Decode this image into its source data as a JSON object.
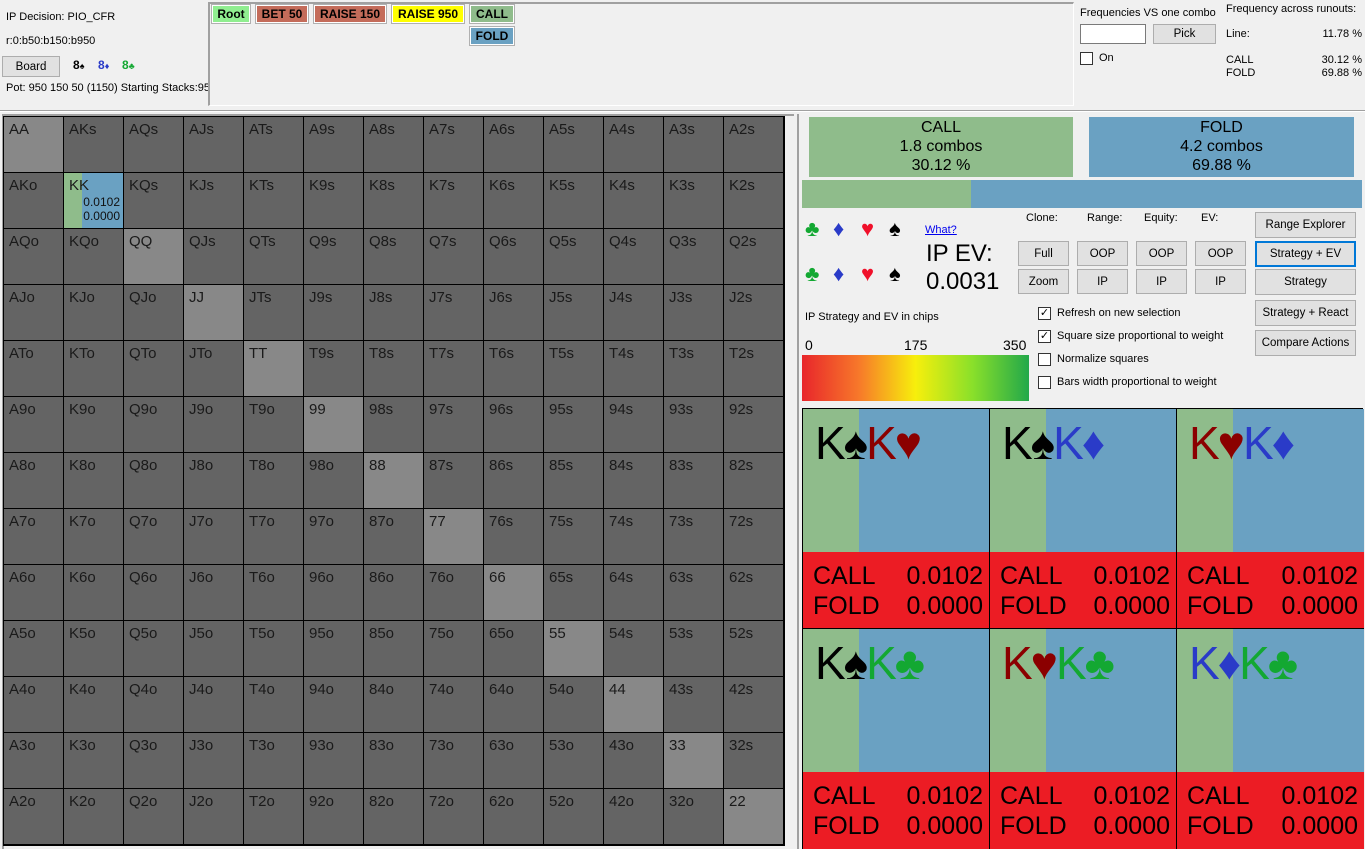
{
  "info": {
    "decision": "IP Decision:  PIO_CFR",
    "line": "r:0:b50:b150:b950",
    "board_button": "Board",
    "board_cards": [
      {
        "rank": "8",
        "suit": "♠",
        "color": "#000000"
      },
      {
        "rank": "8",
        "suit": "♦",
        "color": "#2a3bc8"
      },
      {
        "rank": "8",
        "suit": "♣",
        "color": "#13a832"
      }
    ],
    "pot": "Pot: 950 150 50 (1150) Starting Stacks:95"
  },
  "tree": {
    "nodes": [
      {
        "label": "Root",
        "color": "#90ee90"
      },
      {
        "label": "BET 50",
        "color": "#c46c5a"
      },
      {
        "label": "RAISE 150",
        "color": "#c46c5a"
      },
      {
        "label": "RAISE 950",
        "color": "#ffff00"
      },
      {
        "label": "CALL",
        "color": "#8fbc8b"
      },
      {
        "label": "FOLD",
        "color": "#6aa1c2"
      }
    ]
  },
  "freq_vs_combo": {
    "title": "Frequencies VS one combo",
    "input_value": "",
    "pick_button": "Pick",
    "on_label": "On",
    "on_checked": false
  },
  "freq_runouts": {
    "title": "Frequency across runouts:",
    "line_label": "Line:",
    "line_value": "11.78 %",
    "rows": [
      {
        "label": "CALL",
        "value": "30.12 %"
      },
      {
        "label": "FOLD",
        "value": "69.88 %"
      }
    ]
  },
  "grid": {
    "ranks": [
      "A",
      "K",
      "Q",
      "J",
      "T",
      "9",
      "8",
      "7",
      "6",
      "5",
      "4",
      "3",
      "2"
    ],
    "selected": {
      "hand": "KK",
      "call_frac": 0.3012,
      "ev_call": "0.0102",
      "ev_fold": "0.0000"
    }
  },
  "actions": [
    {
      "label": "CALL",
      "combos": "1.8 combos",
      "pct": "30.12 %",
      "frac": 0.3012,
      "color": "#8fbc8b"
    },
    {
      "label": "FOLD",
      "combos": "4.2 combos",
      "pct": "69.88 %",
      "frac": 0.6988,
      "color": "#6aa1c2"
    }
  ],
  "ev_panel": {
    "what_link": "What?",
    "ev_label": "IP EV:",
    "ev_value": "0.0031",
    "suits_row1": [
      "♣",
      "♦",
      "♥",
      "♠"
    ],
    "suits_row2": [
      "♣",
      "♦",
      "♥",
      "♠"
    ],
    "legend_title": "IP Strategy and EV in chips",
    "gradient_ticks": [
      "0",
      "175",
      "350"
    ]
  },
  "controls": {
    "clone_label": "Clone:",
    "range_label": "Range:",
    "equity_label": "Equity:",
    "ev_label": "EV:",
    "full_button": "Full",
    "zoom_button": "Zoom",
    "oop": "OOP",
    "ip": "IP",
    "range_explorer": "Range Explorer",
    "strategy_ev": "Strategy + EV",
    "strategy": "Strategy",
    "strategy_react": "Strategy + React",
    "compare_actions": "Compare Actions",
    "options": [
      {
        "label": "Refresh on new selection",
        "checked": true
      },
      {
        "label": "Square size proportional to weight",
        "checked": true
      },
      {
        "label": "Normalize squares",
        "checked": false
      },
      {
        "label": "Bars width proportional to weight",
        "checked": false
      }
    ]
  },
  "combos": [
    {
      "cards": [
        {
          "r": "K",
          "s": "♠",
          "cls": "s-spade"
        },
        {
          "r": "K",
          "s": "♥",
          "cls": "s-heart"
        }
      ],
      "call_frac": 0.3012,
      "call": "CALL",
      "call_ev": "0.0102",
      "fold": "FOLD",
      "fold_ev": "0.0000"
    },
    {
      "cards": [
        {
          "r": "K",
          "s": "♠",
          "cls": "s-spade"
        },
        {
          "r": "K",
          "s": "♦",
          "cls": "s-diamond"
        }
      ],
      "call_frac": 0.3012,
      "call": "CALL",
      "call_ev": "0.0102",
      "fold": "FOLD",
      "fold_ev": "0.0000"
    },
    {
      "cards": [
        {
          "r": "K",
          "s": "♥",
          "cls": "s-heart"
        },
        {
          "r": "K",
          "s": "♦",
          "cls": "s-diamond"
        }
      ],
      "call_frac": 0.3012,
      "call": "CALL",
      "call_ev": "0.0102",
      "fold": "FOLD",
      "fold_ev": "0.0000"
    },
    {
      "cards": [
        {
          "r": "K",
          "s": "♠",
          "cls": "s-spade"
        },
        {
          "r": "K",
          "s": "♣",
          "cls": "s-club"
        }
      ],
      "call_frac": 0.3012,
      "call": "CALL",
      "call_ev": "0.0102",
      "fold": "FOLD",
      "fold_ev": "0.0000"
    },
    {
      "cards": [
        {
          "r": "K",
          "s": "♥",
          "cls": "s-heart"
        },
        {
          "r": "K",
          "s": "♣",
          "cls": "s-club"
        }
      ],
      "call_frac": 0.3012,
      "call": "CALL",
      "call_ev": "0.0102",
      "fold": "FOLD",
      "fold_ev": "0.0000"
    },
    {
      "cards": [
        {
          "r": "K",
          "s": "♦",
          "cls": "s-diamond"
        },
        {
          "r": "K",
          "s": "♣",
          "cls": "s-club"
        }
      ],
      "call_frac": 0.3012,
      "call": "CALL",
      "call_ev": "0.0102",
      "fold": "FOLD",
      "fold_ev": "0.0000"
    }
  ]
}
